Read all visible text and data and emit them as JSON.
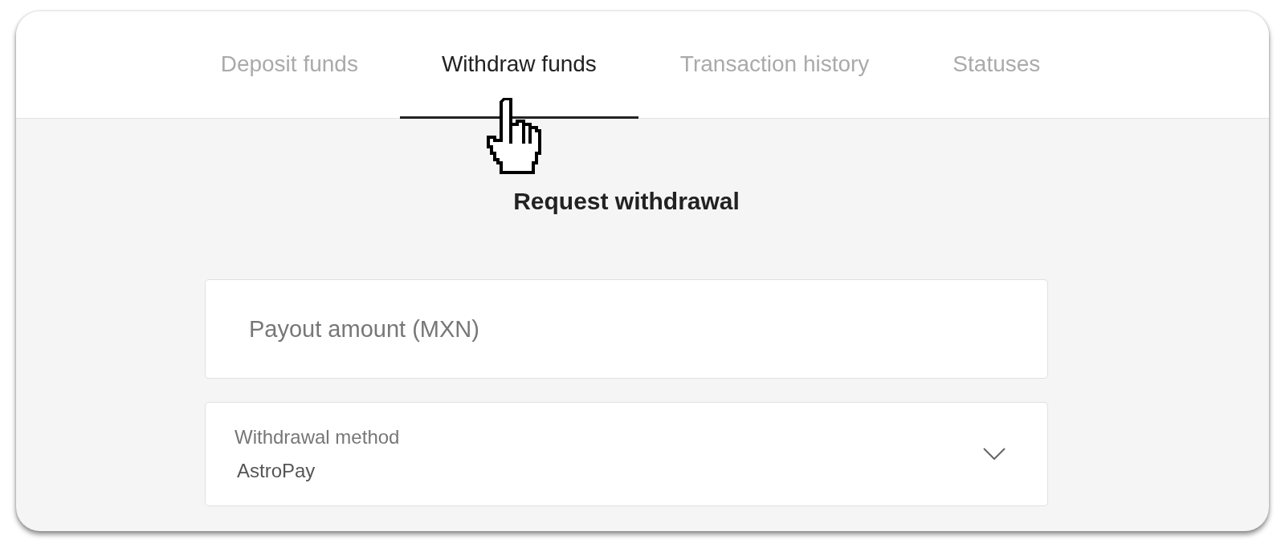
{
  "tabs": [
    {
      "label": "Deposit funds",
      "selected": false
    },
    {
      "label": "Withdraw funds",
      "selected": true
    },
    {
      "label": "Transaction history",
      "selected": false
    },
    {
      "label": "Statuses",
      "selected": false
    }
  ],
  "title": "Request withdrawal",
  "fields": [
    {
      "kind": "input",
      "placeholder": "Payout amount (MXN)"
    },
    {
      "kind": "select",
      "label": "Withdrawal method",
      "value": "AstroPay"
    }
  ]
}
